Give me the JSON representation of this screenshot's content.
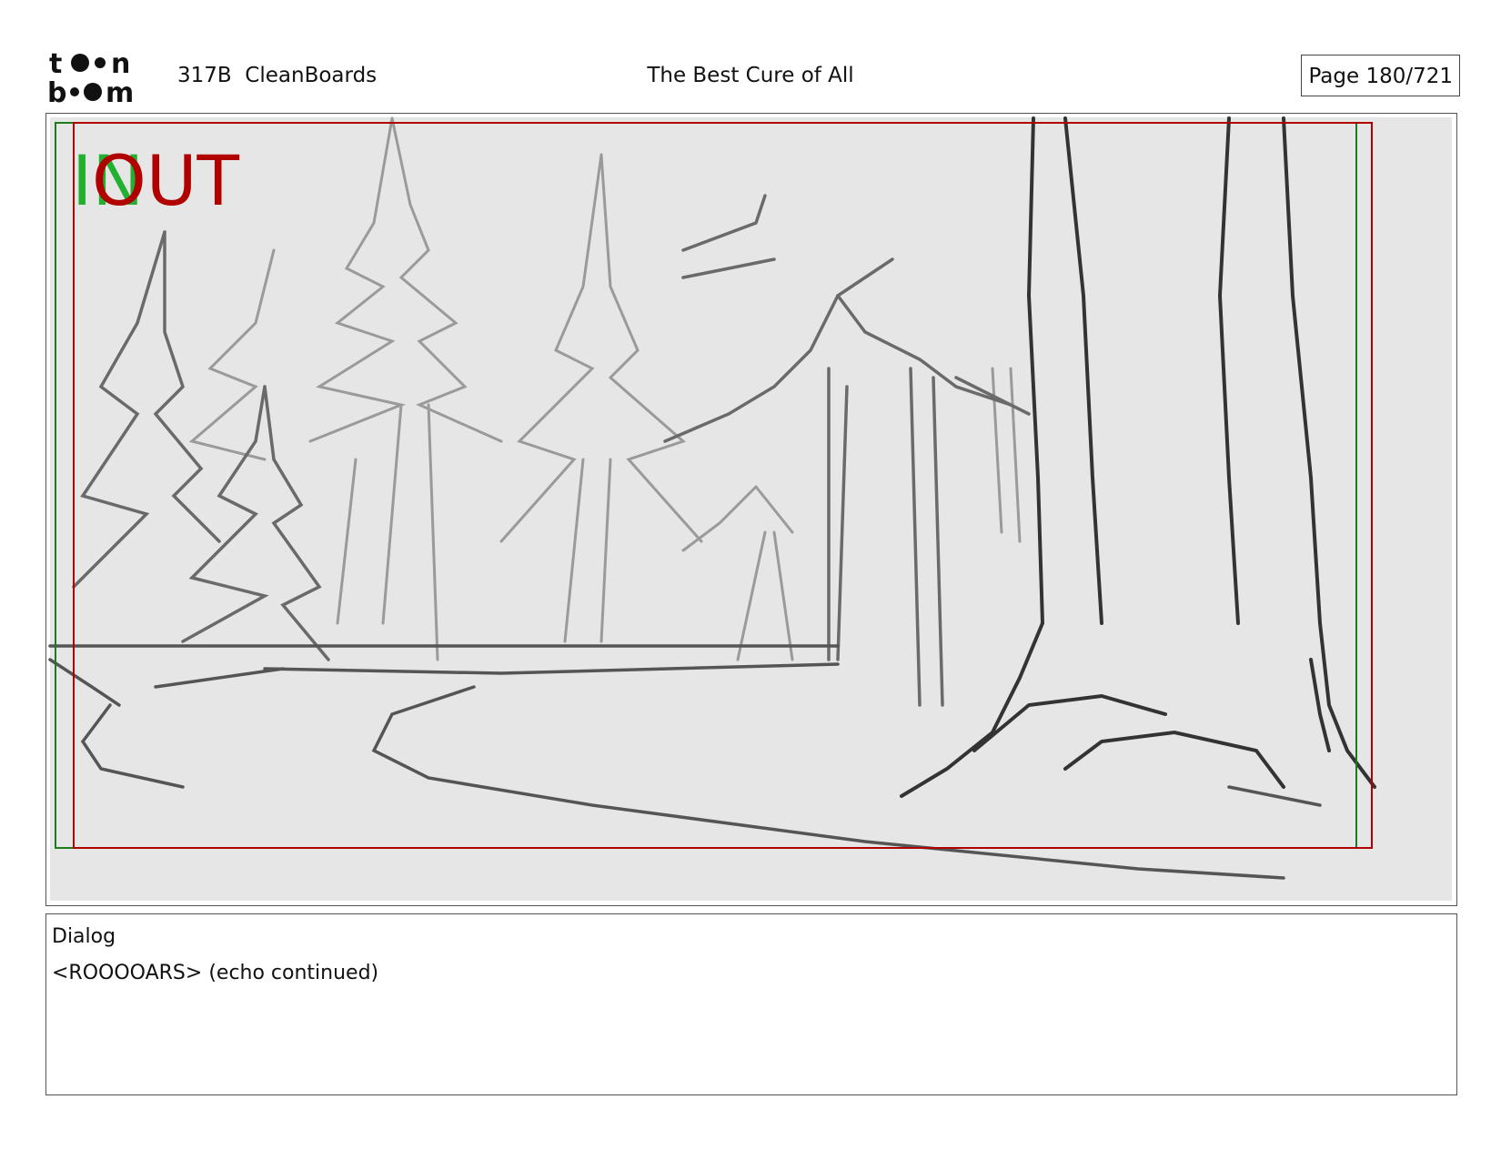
{
  "header": {
    "logo_text": "toon boom",
    "production": "317B  CleanBoards",
    "title": "The Best Cure of All",
    "page": "Page 180/721"
  },
  "panel": {
    "in_label": "IN",
    "out_label": "OUT",
    "colors": {
      "in": "#22b030",
      "out": "#b00000",
      "frame_bg": "#e6e6e6"
    }
  },
  "dialog": {
    "label": "Dialog",
    "text": "<ROOOOARS> (echo continued)"
  }
}
